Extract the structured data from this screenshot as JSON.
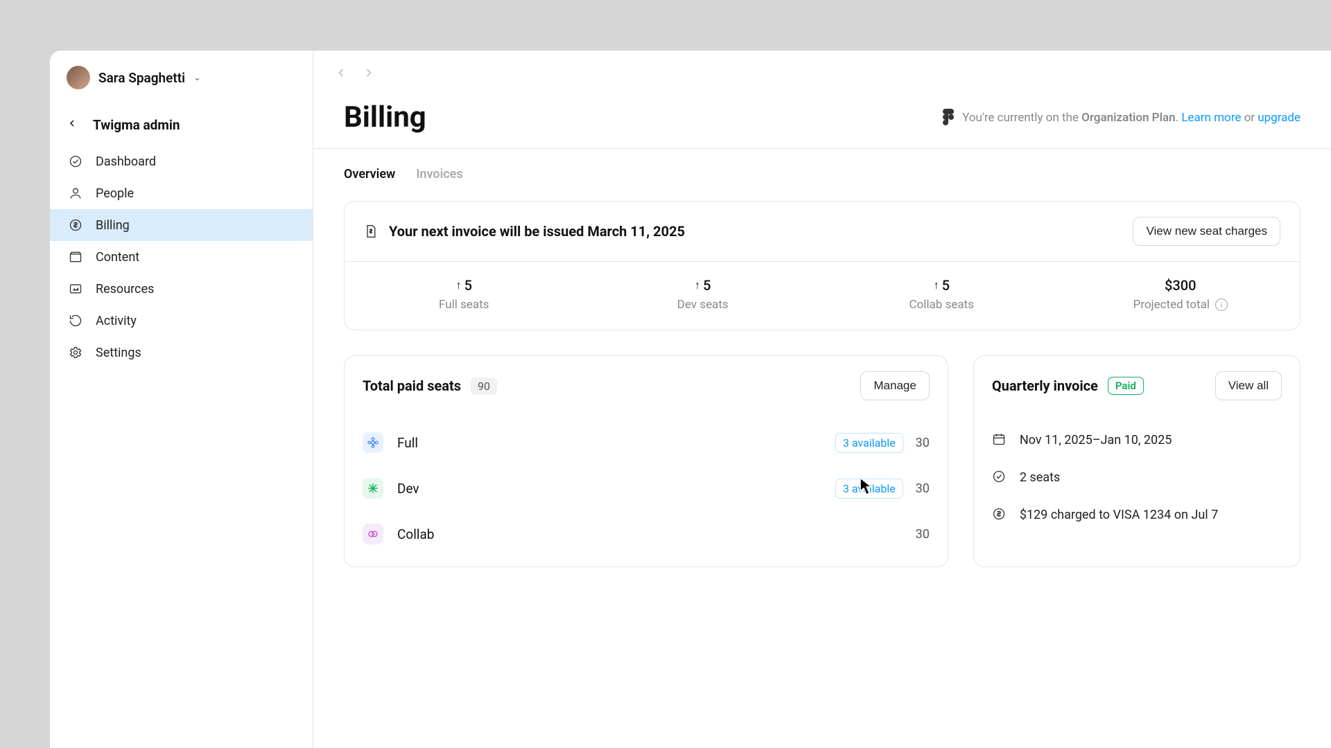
{
  "user": {
    "name": "Sara Spaghetti"
  },
  "org": {
    "title": "Twigma admin"
  },
  "nav": {
    "dashboard": "Dashboard",
    "people": "People",
    "billing": "Billing",
    "content": "Content",
    "resources": "Resources",
    "activity": "Activity",
    "settings": "Settings"
  },
  "page": {
    "title": "Billing"
  },
  "plan_banner": {
    "prefix": "You're currently on the ",
    "plan_name": "Organization Plan",
    "suffix": ". ",
    "learn_more": "Learn more",
    "or": " or ",
    "upgrade": "upgrade"
  },
  "tabs": {
    "overview": "Overview",
    "invoices": "Invoices"
  },
  "next_invoice": {
    "title": "Your next invoice will be issued March 11, 2025",
    "view_button": "View new seat charges",
    "stats": {
      "full_value": "5",
      "full_label": "Full seats",
      "dev_value": "5",
      "dev_label": "Dev seats",
      "collab_value": "5",
      "collab_label": "Collab seats",
      "total_value": "$300",
      "total_label": "Projected total"
    }
  },
  "seats": {
    "title": "Total paid seats",
    "total": "90",
    "manage": "Manage",
    "rows": {
      "full": {
        "name": "Full",
        "available": "3 available",
        "count": "30"
      },
      "dev": {
        "name": "Dev",
        "available": "3 available",
        "count": "30"
      },
      "collab": {
        "name": "Collab",
        "count": "30"
      }
    }
  },
  "quarterly": {
    "title": "Quarterly invoice",
    "paid": "Paid",
    "view_all": "View all",
    "date_range": "Nov 11, 2025–Jan 10, 2025",
    "seats": "2 seats",
    "charge": "$129 charged to VISA 1234 on Jul 7"
  }
}
